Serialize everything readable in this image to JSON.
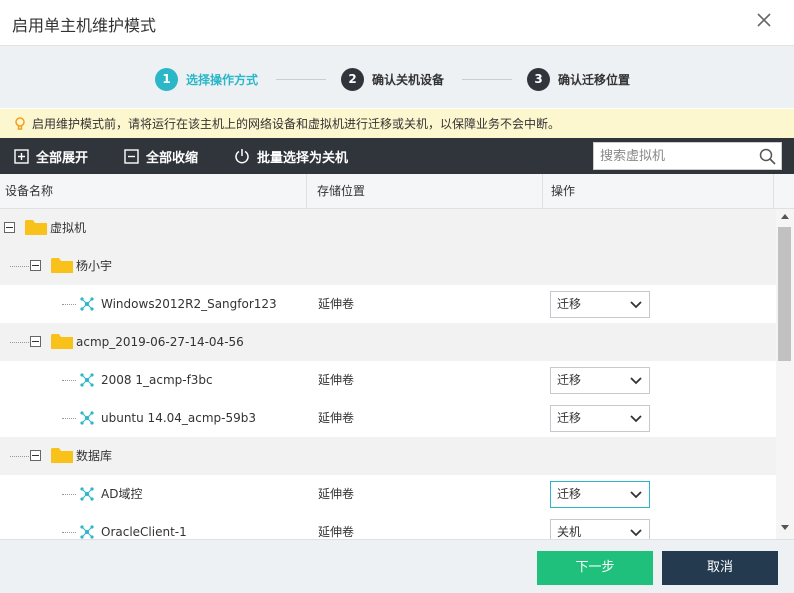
{
  "dialog": {
    "title": "启用单主机维护模式"
  },
  "steps": [
    {
      "num": "1",
      "label": "选择操作方式"
    },
    {
      "num": "2",
      "label": "确认关机设备"
    },
    {
      "num": "3",
      "label": "确认迁移位置"
    }
  ],
  "notice": "启用维护模式前，请将运行在该主机上的网络设备和虚拟机进行迁移或关机，以保障业务不会中断。",
  "toolbar": {
    "expand_all": "全部展开",
    "collapse_all": "全部收缩",
    "batch_shutdown": "批量选择为关机",
    "search_placeholder": "搜索虚拟机"
  },
  "table": {
    "headers": {
      "name": "设备名称",
      "storage": "存储位置",
      "action": "操作"
    },
    "rows": [
      {
        "type": "group",
        "name": "虚拟机"
      },
      {
        "type": "group",
        "name": "杨小宇"
      },
      {
        "type": "leaf",
        "name": "Windows2012R2_Sangfor123",
        "storage": "延伸卷",
        "action": "迁移"
      },
      {
        "type": "group",
        "name": "acmp_2019-06-27-14-04-56"
      },
      {
        "type": "leaf",
        "name": "2008 1_acmp-f3bc",
        "storage": "延伸卷",
        "action": "迁移"
      },
      {
        "type": "leaf",
        "name": "ubuntu 14.04_acmp-59b3",
        "storage": "延伸卷",
        "action": "迁移"
      },
      {
        "type": "group",
        "name": "数据库"
      },
      {
        "type": "leaf",
        "name": "AD域控",
        "storage": "延伸卷",
        "action": "迁移"
      },
      {
        "type": "leaf",
        "name": "OracleClient-1",
        "storage": "延伸卷",
        "action": "关机"
      }
    ]
  },
  "footer": {
    "next": "下一步",
    "cancel": "取消"
  },
  "colors": {
    "accent": "#2bb7c8",
    "toolbar": "#30353c",
    "primary_button": "#1fc07c",
    "secondary_button": "#243a4f",
    "folder": "#f8c21a"
  }
}
